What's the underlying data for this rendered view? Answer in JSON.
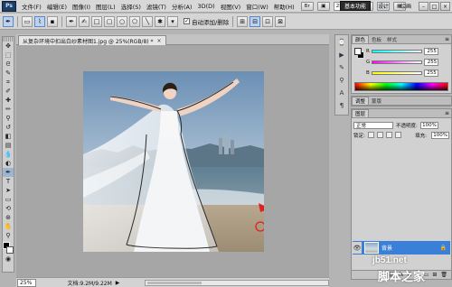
{
  "app": {
    "logo": "Ps",
    "menu": [
      "文件(F)",
      "编辑(E)",
      "图像(I)",
      "图层(L)",
      "选择(S)",
      "滤镜(T)",
      "分析(A)",
      "3D(D)",
      "视图(V)",
      "窗口(W)",
      "帮助(H)"
    ],
    "zoom": "25%",
    "workspaces": [
      "基本功能",
      "设计",
      "绘画"
    ],
    "window_controls": [
      "–",
      "□",
      "×"
    ]
  },
  "options": {
    "auto_add_label": "自动添加/删除",
    "auto_add_checked": true
  },
  "document": {
    "tab_title": "从复杂环境中扣出白纱素材图1.jpg @ 25%(RGB/8) *",
    "close": "×"
  },
  "status": {
    "zoom": "25%",
    "doc_info": "文档:9.2M/9.22M",
    "arrow": "▶"
  },
  "color_panel": {
    "tabs": [
      "颜色",
      "色板",
      "样式"
    ],
    "channels": [
      {
        "label": "R",
        "value": "255"
      },
      {
        "label": "G",
        "value": "255"
      },
      {
        "label": "B",
        "value": "255"
      }
    ]
  },
  "adjust_panel": {
    "tabs": [
      "调整",
      "蒙版"
    ]
  },
  "layers_panel": {
    "tabs": [
      "图层"
    ],
    "blend_mode": "正常",
    "opacity_label": "不透明度:",
    "opacity": "100%",
    "lock_label": "锁定:",
    "fill_label": "填充:",
    "fill": "100%",
    "layer_name": "背景"
  },
  "watermark": {
    "url": "jb51.net",
    "logo_text": "脚本之家"
  },
  "colors": {
    "accent": "#3a80d8",
    "path": "#2a2a2a",
    "marker": "#e02020"
  }
}
